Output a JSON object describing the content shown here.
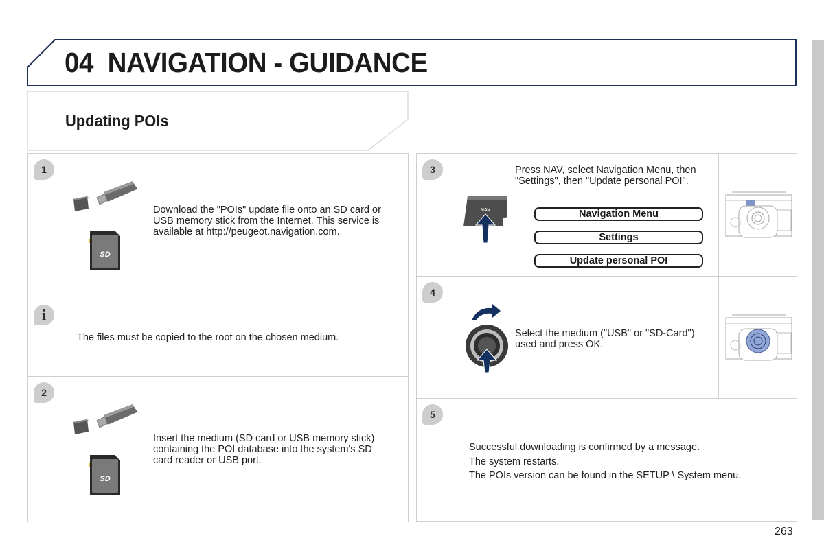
{
  "header": {
    "chapter_number": "04",
    "chapter_title": "NAVIGATION - GUIDANCE",
    "accent_color": "#1e3257"
  },
  "section": {
    "title": "Updating POIs"
  },
  "steps": [
    {
      "badge": "1",
      "icons": [
        "usb-stick-icon",
        "sd-card-icon"
      ],
      "text": "Download the \"POIs\" update file onto an SD card or USB memory stick from the Internet. This service is available at http://peugeot.navigation.com."
    },
    {
      "badge": "i",
      "text": "The files must be copied to the root on the chosen medium."
    },
    {
      "badge": "2",
      "icons": [
        "usb-stick-icon",
        "sd-card-icon"
      ],
      "text": "Insert the medium (SD card or USB memory stick) containing the POI database into the system's SD card reader or USB port."
    },
    {
      "badge": "3",
      "text": "Press NAV, select Navigation Menu, then \"Settings\", then \"Update personal POI\".",
      "nav_button_label": "NAV",
      "menu_items": [
        "Navigation Menu",
        "Settings",
        "Update personal POI"
      ]
    },
    {
      "badge": "4",
      "text": "Select the medium (\"USB\" or \"SD-Card\") used and press OK."
    },
    {
      "badge": "5",
      "lines": [
        "Successful downloading is confirmed by a message.",
        "The system restarts.",
        "The POIs version can be found in the SETUP \\ System menu."
      ]
    }
  ],
  "page_number": "263"
}
